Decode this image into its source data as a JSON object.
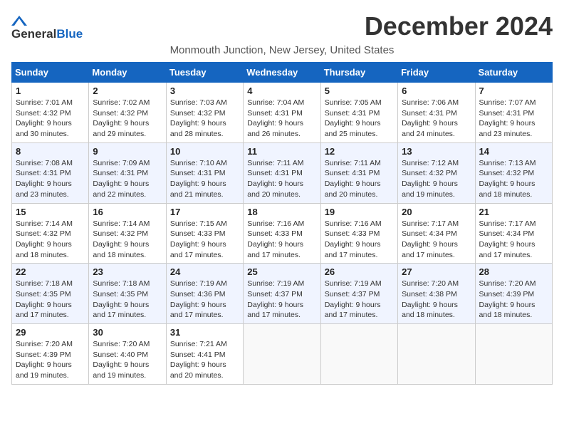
{
  "logo": {
    "general": "General",
    "blue": "Blue"
  },
  "title": "December 2024",
  "subtitle": "Monmouth Junction, New Jersey, United States",
  "days_of_week": [
    "Sunday",
    "Monday",
    "Tuesday",
    "Wednesday",
    "Thursday",
    "Friday",
    "Saturday"
  ],
  "weeks": [
    [
      {
        "day": "1",
        "sunrise": "7:01 AM",
        "sunset": "4:32 PM",
        "daylight": "9 hours and 30 minutes."
      },
      {
        "day": "2",
        "sunrise": "7:02 AM",
        "sunset": "4:32 PM",
        "daylight": "9 hours and 29 minutes."
      },
      {
        "day": "3",
        "sunrise": "7:03 AM",
        "sunset": "4:32 PM",
        "daylight": "9 hours and 28 minutes."
      },
      {
        "day": "4",
        "sunrise": "7:04 AM",
        "sunset": "4:31 PM",
        "daylight": "9 hours and 26 minutes."
      },
      {
        "day": "5",
        "sunrise": "7:05 AM",
        "sunset": "4:31 PM",
        "daylight": "9 hours and 25 minutes."
      },
      {
        "day": "6",
        "sunrise": "7:06 AM",
        "sunset": "4:31 PM",
        "daylight": "9 hours and 24 minutes."
      },
      {
        "day": "7",
        "sunrise": "7:07 AM",
        "sunset": "4:31 PM",
        "daylight": "9 hours and 23 minutes."
      }
    ],
    [
      {
        "day": "8",
        "sunrise": "7:08 AM",
        "sunset": "4:31 PM",
        "daylight": "9 hours and 23 minutes."
      },
      {
        "day": "9",
        "sunrise": "7:09 AM",
        "sunset": "4:31 PM",
        "daylight": "9 hours and 22 minutes."
      },
      {
        "day": "10",
        "sunrise": "7:10 AM",
        "sunset": "4:31 PM",
        "daylight": "9 hours and 21 minutes."
      },
      {
        "day": "11",
        "sunrise": "7:11 AM",
        "sunset": "4:31 PM",
        "daylight": "9 hours and 20 minutes."
      },
      {
        "day": "12",
        "sunrise": "7:11 AM",
        "sunset": "4:31 PM",
        "daylight": "9 hours and 20 minutes."
      },
      {
        "day": "13",
        "sunrise": "7:12 AM",
        "sunset": "4:32 PM",
        "daylight": "9 hours and 19 minutes."
      },
      {
        "day": "14",
        "sunrise": "7:13 AM",
        "sunset": "4:32 PM",
        "daylight": "9 hours and 18 minutes."
      }
    ],
    [
      {
        "day": "15",
        "sunrise": "7:14 AM",
        "sunset": "4:32 PM",
        "daylight": "9 hours and 18 minutes."
      },
      {
        "day": "16",
        "sunrise": "7:14 AM",
        "sunset": "4:32 PM",
        "daylight": "9 hours and 18 minutes."
      },
      {
        "day": "17",
        "sunrise": "7:15 AM",
        "sunset": "4:33 PM",
        "daylight": "9 hours and 17 minutes."
      },
      {
        "day": "18",
        "sunrise": "7:16 AM",
        "sunset": "4:33 PM",
        "daylight": "9 hours and 17 minutes."
      },
      {
        "day": "19",
        "sunrise": "7:16 AM",
        "sunset": "4:33 PM",
        "daylight": "9 hours and 17 minutes."
      },
      {
        "day": "20",
        "sunrise": "7:17 AM",
        "sunset": "4:34 PM",
        "daylight": "9 hours and 17 minutes."
      },
      {
        "day": "21",
        "sunrise": "7:17 AM",
        "sunset": "4:34 PM",
        "daylight": "9 hours and 17 minutes."
      }
    ],
    [
      {
        "day": "22",
        "sunrise": "7:18 AM",
        "sunset": "4:35 PM",
        "daylight": "9 hours and 17 minutes."
      },
      {
        "day": "23",
        "sunrise": "7:18 AM",
        "sunset": "4:35 PM",
        "daylight": "9 hours and 17 minutes."
      },
      {
        "day": "24",
        "sunrise": "7:19 AM",
        "sunset": "4:36 PM",
        "daylight": "9 hours and 17 minutes."
      },
      {
        "day": "25",
        "sunrise": "7:19 AM",
        "sunset": "4:37 PM",
        "daylight": "9 hours and 17 minutes."
      },
      {
        "day": "26",
        "sunrise": "7:19 AM",
        "sunset": "4:37 PM",
        "daylight": "9 hours and 17 minutes."
      },
      {
        "day": "27",
        "sunrise": "7:20 AM",
        "sunset": "4:38 PM",
        "daylight": "9 hours and 18 minutes."
      },
      {
        "day": "28",
        "sunrise": "7:20 AM",
        "sunset": "4:39 PM",
        "daylight": "9 hours and 18 minutes."
      }
    ],
    [
      {
        "day": "29",
        "sunrise": "7:20 AM",
        "sunset": "4:39 PM",
        "daylight": "9 hours and 19 minutes."
      },
      {
        "day": "30",
        "sunrise": "7:20 AM",
        "sunset": "4:40 PM",
        "daylight": "9 hours and 19 minutes."
      },
      {
        "day": "31",
        "sunrise": "7:21 AM",
        "sunset": "4:41 PM",
        "daylight": "9 hours and 20 minutes."
      },
      null,
      null,
      null,
      null
    ]
  ],
  "labels": {
    "sunrise": "Sunrise:",
    "sunset": "Sunset:",
    "daylight": "Daylight:"
  }
}
